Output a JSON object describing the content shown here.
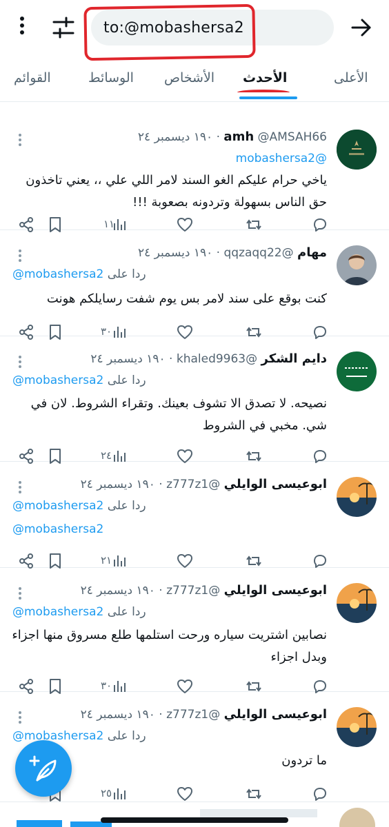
{
  "search": {
    "query": "to:@mobashersa2"
  },
  "tabs": [
    {
      "label": "الأعلى",
      "active": false
    },
    {
      "label": "الأحدث",
      "active": true
    },
    {
      "label": "الأشخاص",
      "active": false
    },
    {
      "label": "الوسائط",
      "active": false
    },
    {
      "label": "القوائم",
      "active": false
    }
  ],
  "colors": {
    "accent": "#1d9bf0",
    "annotation": "#e0262c",
    "secondary_text": "#536471"
  },
  "icons": {
    "menu": "more-vertical-icon",
    "filter": "tune-sliders-icon",
    "forward": "arrow-right-icon",
    "reply": "reply-bubble-icon",
    "retweet": "retweet-icon",
    "like": "heart-icon",
    "views": "views-bar-icon",
    "bookmark": "bookmark-icon",
    "share": "share-icon",
    "compose": "compose-feather-icon"
  },
  "tweets": [
    {
      "name": "amh",
      "handle": "@AMSAH66",
      "time": "١٩٠ ديسمبر ٢٤",
      "reply_label": "",
      "mention": "@mobashersa2",
      "text": [
        "ياخي حرام عليكم الغو السند لامر اللي علي ،، يعني تاخذون",
        "حق الناس بسهولة وتردونه بصعوبة !!!"
      ],
      "views": "١١"
    },
    {
      "name": "مهام",
      "handle": "@qqzaqq22",
      "time": "١٩٠ ديسمبر ٢٤",
      "reply_label": "ردا على",
      "mention": "@mobashersa2",
      "text": [
        "كنت بوقع على سند لامر بس يوم شفت رسايلكم هونت"
      ],
      "views": "٣٠"
    },
    {
      "name": "دايم الشكر",
      "handle": "@khaled9963",
      "time": "١٩٠ ديسمبر ٢٤",
      "reply_label": "ردا على",
      "mention": "@mobashersa2",
      "text": [
        "نصيحه. لا تصدق الا تشوف بعينك. وتقراء الشروط. لان في",
        "شي.  مخبي في الشروط"
      ],
      "views": "٢٤"
    },
    {
      "name": "ابوعيسى الوايلي",
      "handle": "@z777z1",
      "time": "١٩٠ ديسمبر ٢٤",
      "reply_label": "ردا على",
      "mention": "@mobashersa2",
      "text": [
        "@mobashersa2"
      ],
      "views": "٢١"
    },
    {
      "name": "ابوعيسى الوايلي",
      "handle": "@z777z1",
      "time": "١٩٠ ديسمبر ٢٤",
      "reply_label": "ردا على",
      "mention": "@mobashersa2",
      "text": [
        "نصابين اشتريت سياره ورحت استلمها طلع مسروق منها اجزاء",
        "وبدل اجزاء"
      ],
      "views": "٣٠"
    },
    {
      "name": "ابوعيسى الوايلي",
      "handle": "@z777z1",
      "time": "١٩٠ ديسمبر ٢٤",
      "reply_label": "ردا على",
      "mention": "@mobashersa2",
      "text": [
        "ما تردون"
      ],
      "views": "٢٥"
    }
  ]
}
